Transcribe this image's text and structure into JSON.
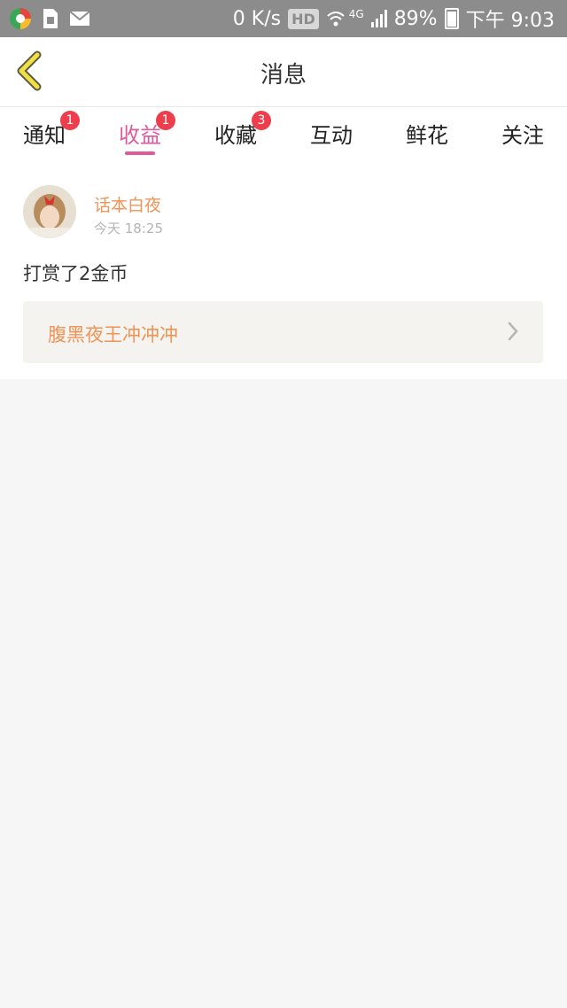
{
  "status_bar": {
    "net_speed": "0 K/s",
    "hd": "HD",
    "network": "4G",
    "battery": "89%",
    "time": "下午 9:03"
  },
  "header": {
    "title": "消息",
    "back_icon": "chevron-left-icon"
  },
  "tabs": [
    {
      "label": "通知",
      "badge": "1"
    },
    {
      "label": "收益",
      "badge": "1",
      "active": true
    },
    {
      "label": "收藏",
      "badge": "3"
    },
    {
      "label": "互动",
      "badge": ""
    },
    {
      "label": "鲜花",
      "badge": ""
    },
    {
      "label": "关注",
      "badge": ""
    }
  ],
  "message": {
    "username": "话本白夜",
    "time": "今天 18:25",
    "text": "打赏了2金币",
    "link_title": "腹黑夜王冲冲冲"
  },
  "colors": {
    "accent_pink": "#e05a9a",
    "badge_red": "#ec3e4c",
    "username_orange": "#f09356"
  }
}
